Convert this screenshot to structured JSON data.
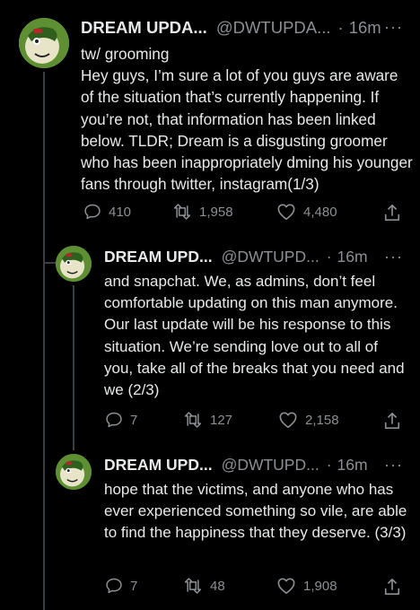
{
  "colors": {
    "background": "#000000",
    "text": "#e7e9ea",
    "secondary": "#8b8f94",
    "thread_line": "#3a3d40"
  },
  "tweets": [
    {
      "name": "DREAM UPDA...",
      "handle": "@DWTUPDA...",
      "time": "16m",
      "more": "···",
      "content": "tw/ grooming\nHey guys, I’m sure a lot of you guys are aware of the situation that’s currently happening. If you’re not, that information has been linked below. TLDR; Dream is a disgusting groomer who has been inappropriately dming his younger fans through twitter, instagram(1/3)",
      "replies": "410",
      "retweets": "1,958",
      "likes": "4,480"
    },
    {
      "name": "DREAM UPD...",
      "handle": "@DWTUPD...",
      "time": "16m",
      "more": "···",
      "content": "and snapchat. We, as admins, don’t feel comfortable updating on this man anymore. Our last update will be his response to this situation. We’re sending love out to all of you, take all of the breaks that you need and we (2/3)",
      "replies": "7",
      "retweets": "127",
      "likes": "2,158"
    },
    {
      "name": "DREAM UPD...",
      "handle": "@DWTUPD...",
      "time": "16m",
      "more": "···",
      "content": "hope that the victims, and anyone who has ever experienced something so vile, are able to find the happiness that they deserve. (3/3)",
      "replies": "7",
      "retweets": "48",
      "likes": "1,908"
    }
  ]
}
